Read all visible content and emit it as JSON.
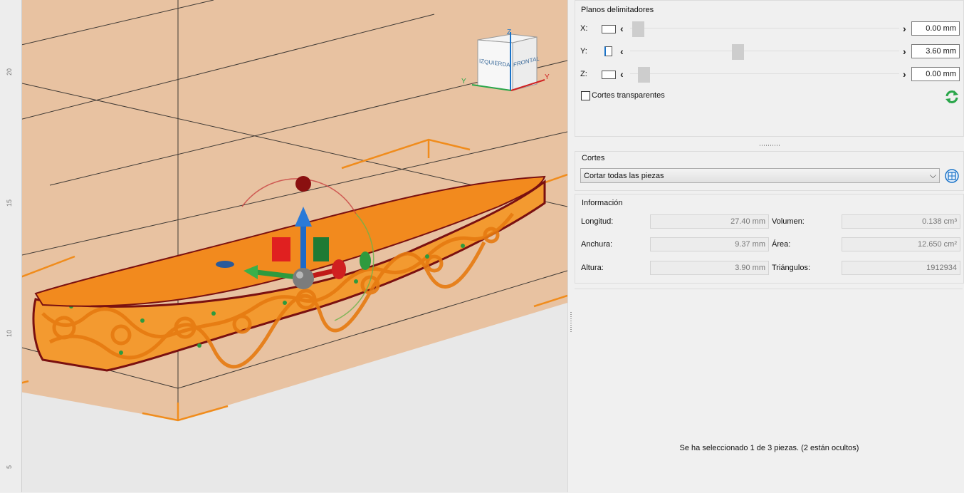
{
  "viewport": {
    "ruler_ticks": [
      "20",
      "15",
      "10",
      "5"
    ],
    "view_cube": {
      "faces": [
        "IZQUIERDA",
        "FRONTAL"
      ],
      "axis_labels": {
        "y": "Y",
        "x": "Y",
        "z": "Z"
      }
    }
  },
  "bounding_planes": {
    "title": "Planos delimitadores",
    "rows": [
      {
        "label": "X:",
        "value": "0.00 mm",
        "fraction": 0.0
      },
      {
        "label": "Y:",
        "value": "3.60 mm",
        "fraction": 0.38
      },
      {
        "label": "Z:",
        "value": "0.00 mm",
        "fraction": 0.02
      }
    ],
    "transparent_cuts_label": "Cortes transparentes",
    "transparent_cuts_checked": false
  },
  "cuts": {
    "title": "Cortes",
    "selected": "Cortar todas las piezas"
  },
  "info": {
    "title": "Información",
    "length_label": "Longitud:",
    "length_value": "27.40 mm",
    "width_label": "Anchura:",
    "width_value": "9.37 mm",
    "height_label": "Altura:",
    "height_value": "3.90 mm",
    "volume_label": "Volumen:",
    "volume_value": "0.138 cm³",
    "area_label": "Área:",
    "area_value": "12.650 cm²",
    "triangles_label": "Triángulos:",
    "triangles_value": "1912934"
  },
  "status": "Se ha seleccionado 1 de 3 piezas. (2 están ocultos)",
  "colors": {
    "accent": "#1a73c8",
    "part": "#f28a1e",
    "build_volume": "#e9c3a3",
    "refresh": "#2aa64a"
  }
}
